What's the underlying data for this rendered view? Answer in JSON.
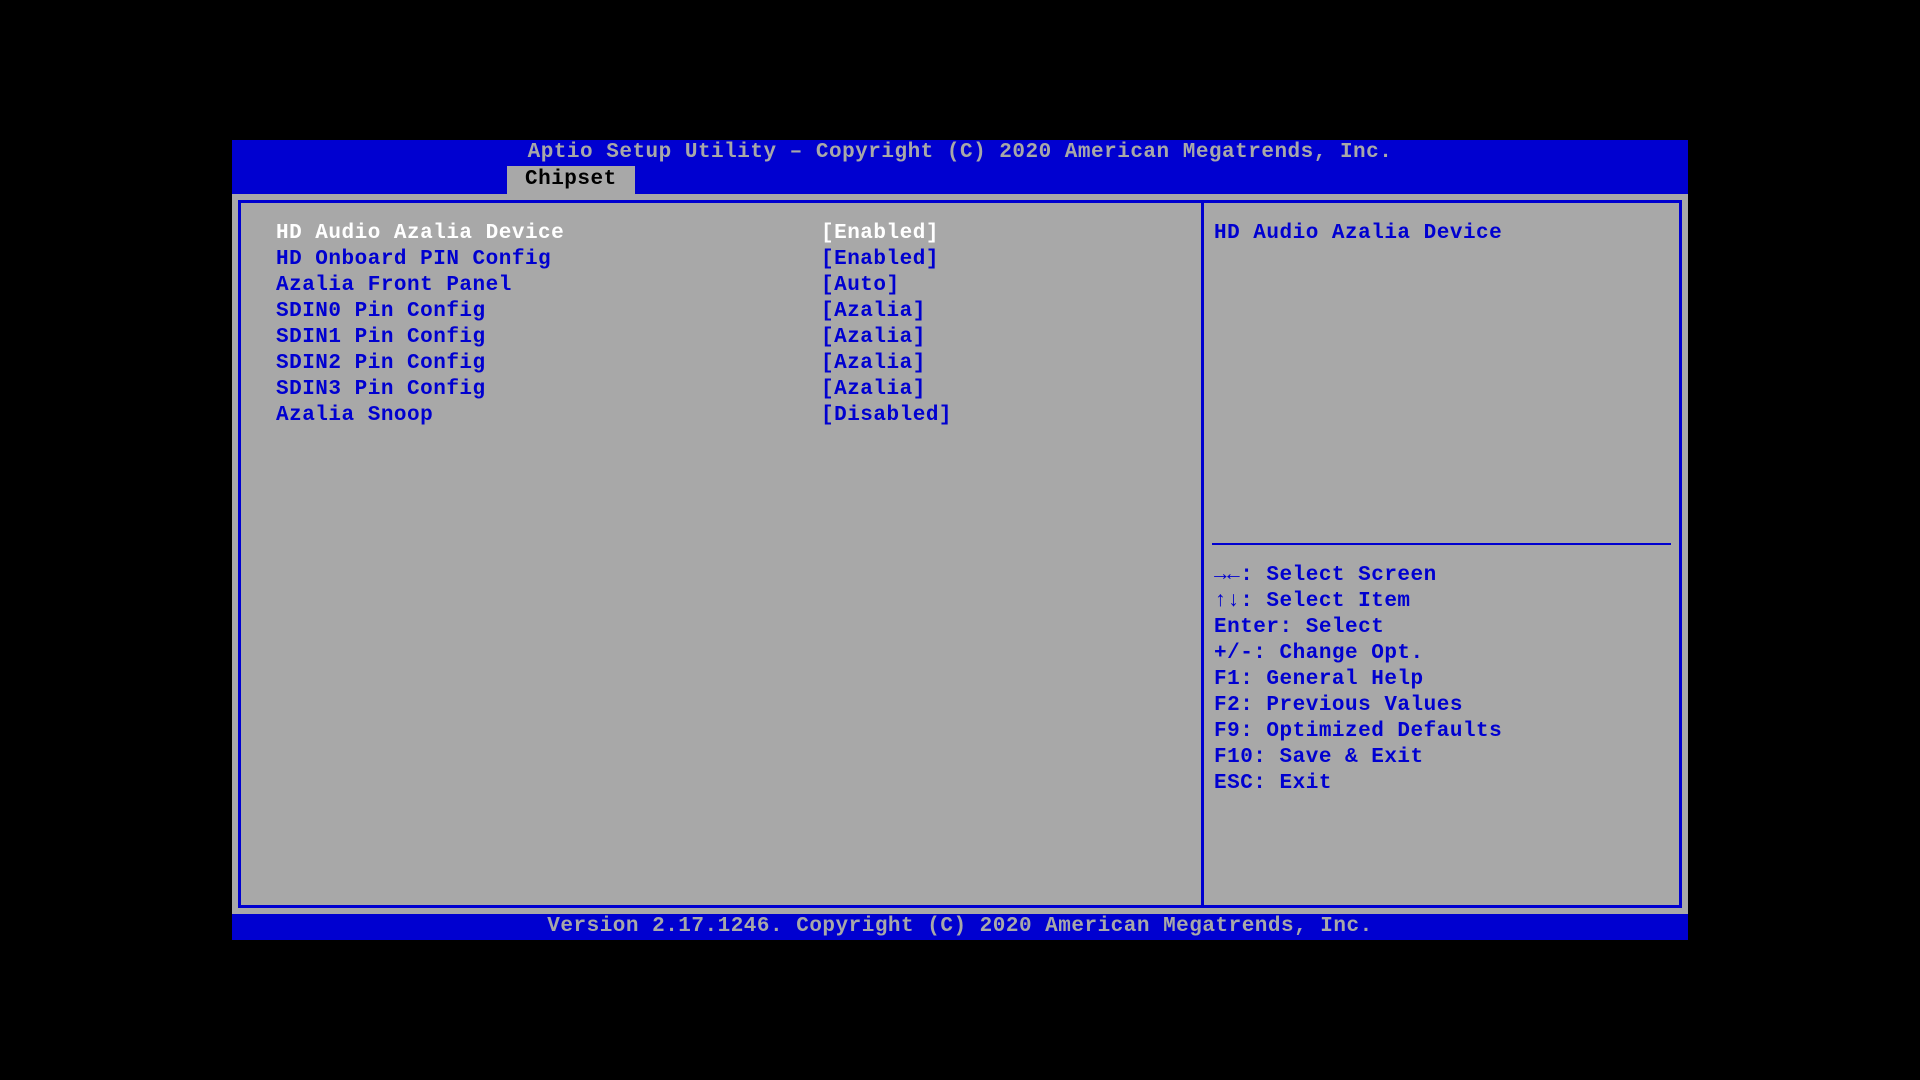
{
  "title": "Aptio Setup Utility – Copyright (C) 2020 American Megatrends, Inc.",
  "tab": "Chipset",
  "settings": [
    {
      "label": "HD Audio Azalia Device",
      "value": "[Enabled]",
      "selected": true
    },
    {
      "label": "HD Onboard PIN Config",
      "value": "[Enabled]",
      "selected": false
    },
    {
      "label": "Azalia Front Panel",
      "value": "[Auto]",
      "selected": false
    },
    {
      "label": "SDIN0 Pin Config",
      "value": "[Azalia]",
      "selected": false
    },
    {
      "label": "SDIN1 Pin Config",
      "value": "[Azalia]",
      "selected": false
    },
    {
      "label": "SDIN2 Pin Config",
      "value": "[Azalia]",
      "selected": false
    },
    {
      "label": "SDIN3 Pin Config",
      "value": "[Azalia]",
      "selected": false
    },
    {
      "label": "Azalia Snoop",
      "value": "[Disabled]",
      "selected": false
    }
  ],
  "help_title": "HD Audio Azalia Device",
  "help_keys": [
    "→←: Select Screen",
    "↑↓: Select Item",
    "Enter: Select",
    "+/-: Change Opt.",
    "F1: General Help",
    "F2: Previous Values",
    "F9: Optimized Defaults",
    "F10: Save & Exit",
    "ESC: Exit"
  ],
  "footer": "Version 2.17.1246. Copyright (C) 2020 American Megatrends, Inc."
}
